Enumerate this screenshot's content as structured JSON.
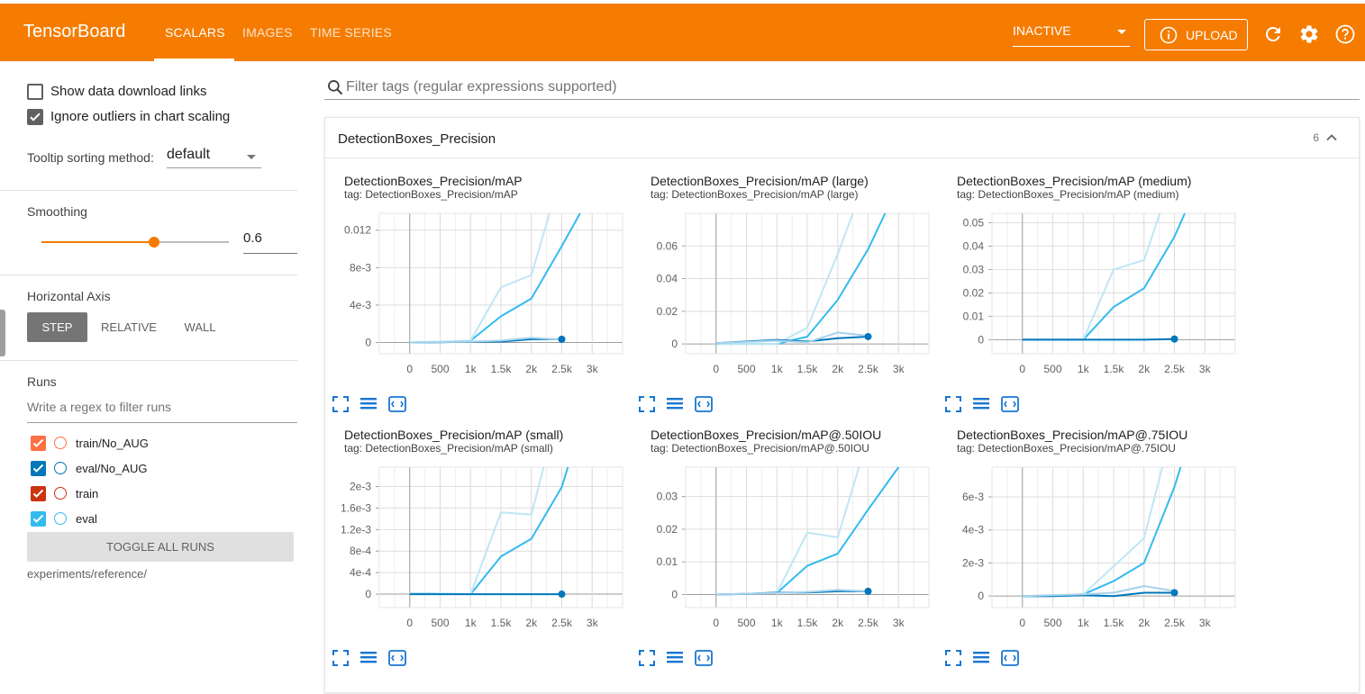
{
  "header": {
    "brand": "TensorBoard",
    "tabs": [
      {
        "label": "SCALARS",
        "active": true
      },
      {
        "label": "IMAGES",
        "active": false
      },
      {
        "label": "TIME SERIES",
        "active": false
      }
    ],
    "run_selector": "INACTIVE",
    "upload_label": "UPLOAD",
    "icons": [
      "info-icon",
      "refresh-icon",
      "settings-icon",
      "help-icon"
    ],
    "accent_color": "#f57c00"
  },
  "sidebar": {
    "show_download_links": {
      "label": "Show data download links",
      "checked": false
    },
    "ignore_outliers": {
      "label": "Ignore outliers in chart scaling",
      "checked": true
    },
    "tooltip_sorting": {
      "label": "Tooltip sorting method:",
      "value": "default"
    },
    "smoothing": {
      "label": "Smoothing",
      "value": "0.6",
      "level": 0.6
    },
    "horizontal_axis": {
      "label": "Horizontal Axis",
      "options": [
        "STEP",
        "RELATIVE",
        "WALL"
      ],
      "selected": "STEP"
    },
    "runs": {
      "label": "Runs",
      "filter_placeholder": "Write a regex to filter runs",
      "items": [
        {
          "name": "train/No_AUG",
          "color": "#ff7043",
          "checked": true
        },
        {
          "name": "eval/No_AUG",
          "color": "#0077bb",
          "checked": true
        },
        {
          "name": "train",
          "color": "#cc3311",
          "checked": true
        },
        {
          "name": "eval",
          "color": "#33bbee",
          "checked": true
        }
      ],
      "toggle_all": "TOGGLE ALL RUNS",
      "logdir": "experiments/reference/"
    }
  },
  "main": {
    "filter_placeholder": "Filter tags (regular expressions supported)",
    "panel": {
      "title": "DetectionBoxes_Precision",
      "count": "6"
    }
  },
  "chart_data": [
    {
      "type": "line",
      "title": "DetectionBoxes_Precision/mAP",
      "tag": "tag: DetectionBoxes_Precision/mAP",
      "xticks": [
        "0",
        "500",
        "1k",
        "1.5k",
        "2k",
        "2.5k",
        "3k"
      ],
      "yticks": [
        "0",
        "4e-3",
        "8e-3",
        "0.012"
      ],
      "ylim": [
        -0.0012,
        0.0138
      ],
      "xlim": [
        -500,
        3500
      ],
      "series": [
        {
          "color": "#33bbee",
          "x": [
            0,
            500,
            1000,
            1500,
            2000,
            2500,
            2800
          ],
          "y": [
            0,
            5e-05,
            0.0002,
            0.0028,
            0.0047,
            0.0103,
            0.0138
          ]
        },
        {
          "color": "#bfe6f5",
          "x": [
            0,
            500,
            1000,
            1500,
            2000,
            2300
          ],
          "y": [
            0,
            0.0001,
            0.0002,
            0.0059,
            0.0072,
            0.0138
          ]
        },
        {
          "color": "#0077bb",
          "x": [
            0,
            500,
            1000,
            1500,
            2000,
            2500
          ],
          "y": [
            0,
            3e-05,
            8e-05,
            0.0001,
            0.00035,
            0.00035
          ]
        },
        {
          "color": "#a7d3ec",
          "x": [
            0,
            1000,
            1500,
            2000,
            2500
          ],
          "y": [
            0,
            0.0001,
            0.0002,
            0.0005,
            0.0003
          ]
        }
      ],
      "marker": {
        "x": 2500,
        "y": 0.00035
      }
    },
    {
      "type": "line",
      "title": "DetectionBoxes_Precision/mAP (large)",
      "tag": "tag: DetectionBoxes_Precision/mAP (large)",
      "xticks": [
        "0",
        "500",
        "1k",
        "1.5k",
        "2k",
        "2.5k",
        "3k"
      ],
      "yticks": [
        "0",
        "0.02",
        "0.04",
        "0.06"
      ],
      "ylim": [
        -0.006,
        0.08
      ],
      "xlim": [
        -500,
        3500
      ],
      "series": [
        {
          "color": "#33bbee",
          "x": [
            0,
            500,
            1000,
            1500,
            2000,
            2500,
            2780
          ],
          "y": [
            0,
            0,
            0,
            0.0045,
            0.027,
            0.058,
            0.08
          ]
        },
        {
          "color": "#bfe6f5",
          "x": [
            0,
            1000,
            1500,
            2000,
            2250
          ],
          "y": [
            0,
            0,
            0.01,
            0.055,
            0.08
          ]
        },
        {
          "color": "#0077bb",
          "x": [
            0,
            500,
            1000,
            1500,
            2000,
            2500
          ],
          "y": [
            0.0005,
            0.0015,
            0.0025,
            0.0015,
            0.0035,
            0.0045
          ]
        },
        {
          "color": "#a7d3ec",
          "x": [
            0,
            1000,
            1500,
            2000,
            2500
          ],
          "y": [
            0.0005,
            0.002,
            0.001,
            0.007,
            0.005
          ]
        }
      ],
      "marker": {
        "x": 2500,
        "y": 0.0045
      }
    },
    {
      "type": "line",
      "title": "DetectionBoxes_Precision/mAP (medium)",
      "tag": "tag: DetectionBoxes_Precision/mAP (medium)",
      "xticks": [
        "0",
        "500",
        "1k",
        "1.5k",
        "2k",
        "2.5k",
        "3k"
      ],
      "yticks": [
        "0",
        "0.01",
        "0.02",
        "0.03",
        "0.04",
        "0.05"
      ],
      "ylim": [
        -0.006,
        0.054
      ],
      "xlim": [
        -500,
        3500
      ],
      "series": [
        {
          "color": "#33bbee",
          "x": [
            0,
            500,
            1000,
            1500,
            2000,
            2500,
            2670
          ],
          "y": [
            0,
            0,
            0,
            0.014,
            0.022,
            0.044,
            0.054
          ]
        },
        {
          "color": "#bfe6f5",
          "x": [
            0,
            1000,
            1500,
            2000,
            2260
          ],
          "y": [
            0,
            0,
            0.03,
            0.034,
            0.054
          ]
        },
        {
          "color": "#0077bb",
          "x": [
            0,
            500,
            1000,
            1500,
            2000,
            2500
          ],
          "y": [
            0,
            0,
            0,
            0,
            0,
            0.0003
          ]
        }
      ],
      "marker": {
        "x": 2500,
        "y": 0.0003
      }
    },
    {
      "type": "line",
      "title": "DetectionBoxes_Precision/mAP (small)",
      "tag": "tag: DetectionBoxes_Precision/mAP (small)",
      "xticks": [
        "0",
        "500",
        "1k",
        "1.5k",
        "2k",
        "2.5k",
        "3k"
      ],
      "yticks": [
        "0",
        "4e-4",
        "8e-4",
        "1.2e-3",
        "1.6e-3",
        "2e-3"
      ],
      "ylim": [
        -0.00025,
        0.00236
      ],
      "xlim": [
        -500,
        3500
      ],
      "series": [
        {
          "color": "#33bbee",
          "x": [
            0,
            500,
            1000,
            1500,
            2000,
            2500,
            2600
          ],
          "y": [
            2e-05,
            1e-05,
            0,
            0.0007,
            0.00103,
            0.00199,
            0.00236
          ]
        },
        {
          "color": "#bfe6f5",
          "x": [
            0,
            1000,
            1500,
            2000,
            2200
          ],
          "y": [
            2e-05,
            0,
            0.00152,
            0.00148,
            0.00236
          ]
        },
        {
          "color": "#0077bb",
          "x": [
            0,
            500,
            1000,
            1500,
            2000,
            2500
          ],
          "y": [
            0,
            0,
            0,
            0,
            0,
            0
          ]
        }
      ],
      "marker": {
        "x": 2500,
        "y": 0
      }
    },
    {
      "type": "line",
      "title": "DetectionBoxes_Precision/mAP@.50IOU",
      "tag": "tag: DetectionBoxes_Precision/mAP@.50IOU",
      "xticks": [
        "0",
        "500",
        "1k",
        "1.5k",
        "2k",
        "2.5k",
        "3k"
      ],
      "yticks": [
        "0",
        "0.01",
        "0.02",
        "0.03"
      ],
      "ylim": [
        -0.004,
        0.039
      ],
      "xlim": [
        -500,
        3500
      ],
      "series": [
        {
          "color": "#33bbee",
          "x": [
            0,
            500,
            1000,
            1500,
            2000,
            2500,
            3000
          ],
          "y": [
            0,
            0.0002,
            0.0005,
            0.0088,
            0.0125,
            0.026,
            0.039
          ]
        },
        {
          "color": "#bfe6f5",
          "x": [
            0,
            1000,
            1500,
            2000,
            2350
          ],
          "y": [
            0,
            0.0005,
            0.019,
            0.0175,
            0.039
          ]
        },
        {
          "color": "#0077bb",
          "x": [
            0,
            500,
            1000,
            1500,
            2000,
            2500
          ],
          "y": [
            0,
            0.0002,
            0.0006,
            0.0006,
            0.001,
            0.001
          ]
        },
        {
          "color": "#a7d3ec",
          "x": [
            0,
            1000,
            1500,
            2000,
            2500
          ],
          "y": [
            0,
            0.0005,
            0.0008,
            0.0014,
            0.001
          ]
        }
      ],
      "marker": {
        "x": 2500,
        "y": 0.001
      }
    },
    {
      "type": "line",
      "title": "DetectionBoxes_Precision/mAP@.75IOU",
      "tag": "tag: DetectionBoxes_Precision/mAP@.75IOU",
      "xticks": [
        "0",
        "500",
        "1k",
        "1.5k",
        "2k",
        "2.5k",
        "3k"
      ],
      "yticks": [
        "0",
        "2e-3",
        "4e-3",
        "6e-3"
      ],
      "ylim": [
        -0.0007,
        0.0078
      ],
      "xlim": [
        -500,
        3500
      ],
      "series": [
        {
          "color": "#33bbee",
          "x": [
            0,
            500,
            1000,
            1500,
            2000,
            2500,
            2600
          ],
          "y": [
            0,
            0,
            0.0001,
            0.0009,
            0.002,
            0.0066,
            0.0078
          ]
        },
        {
          "color": "#bfe6f5",
          "x": [
            0,
            1000,
            1500,
            2000,
            2300
          ],
          "y": [
            0,
            0.0001,
            0.0018,
            0.0035,
            0.0078
          ]
        },
        {
          "color": "#0077bb",
          "x": [
            0,
            500,
            1000,
            1500,
            2000,
            2500
          ],
          "y": [
            0,
            0,
            5e-05,
            0,
            0.0002,
            0.0002
          ]
        },
        {
          "color": "#a7d3ec",
          "x": [
            0,
            1000,
            1500,
            2000,
            2500
          ],
          "y": [
            0,
            0.0001,
            0.0002,
            0.0006,
            0.0003
          ]
        }
      ],
      "marker": {
        "x": 2500,
        "y": 0.0002
      }
    }
  ]
}
